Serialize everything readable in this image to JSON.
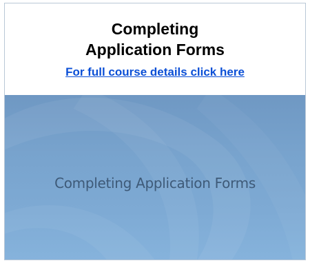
{
  "card": {
    "title_line1": "Completing",
    "title_line2": "Application Forms",
    "link_text": "For full course details click here"
  },
  "thumbnail": {
    "caption": "Completing Application Forms"
  },
  "colors": {
    "link": "#0b4fd6",
    "thumbnail_bg": "#7eaad4",
    "thumbnail_text": "#3e5a78"
  }
}
